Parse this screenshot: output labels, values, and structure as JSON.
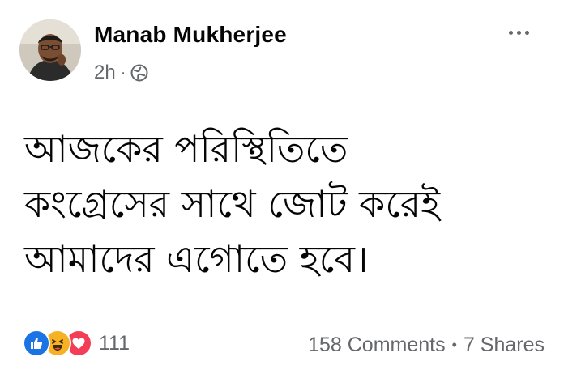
{
  "post": {
    "author": "Manab Mukherjee",
    "time": "2h",
    "separator": "·",
    "privacy_icon": "globe-icon",
    "more_icon": "more-options-icon",
    "text": "আজকের পরিস্থিতিতে\nকংগ্রেসের সাথে জোট করেই\nআমাদের এগোতে হবে।"
  },
  "footer": {
    "reaction_icons": [
      "like-icon",
      "haha-icon",
      "love-icon"
    ],
    "reaction_count": "111",
    "comments": "158 Comments",
    "separator": "•",
    "shares": "7 Shares"
  },
  "colors": {
    "like": "#1b74e4",
    "haha": "#f7b125",
    "love": "#f33e58",
    "secondary_text": "#65676b",
    "primary_text": "#050505"
  }
}
